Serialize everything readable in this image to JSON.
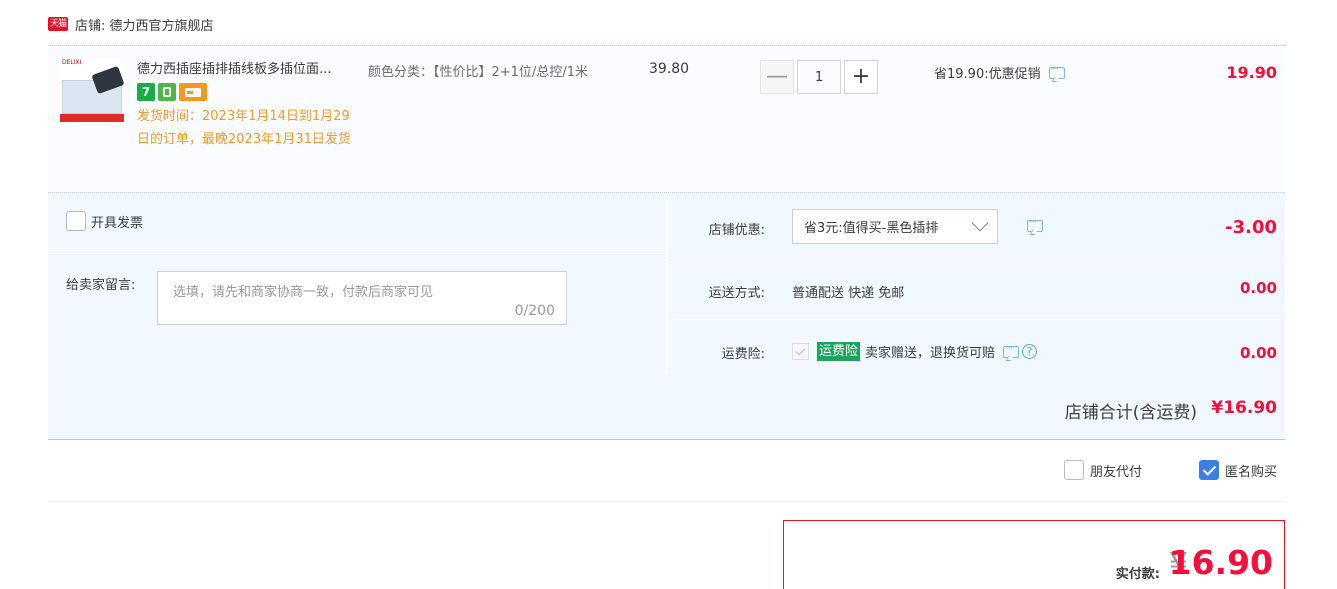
{
  "shop": {
    "badge": "天猫",
    "name": "店铺: 德力西官方旗舰店"
  },
  "item": {
    "title": "德力西插座插排插线板多插位面...",
    "badges": [
      {
        "type": "number",
        "text": "7"
      },
      {
        "type": "icon",
        "icon": "refund-icon"
      },
      {
        "type": "icon",
        "icon": "card-icon"
      }
    ],
    "ship_note": "发货时间：2023年1月14日到1月29日的订单，最晚2023年1月31日发货",
    "sku": "颜色分类：【性价比】2+1位/总控/1米",
    "unit_price": "39.80",
    "quantity": "1",
    "qty_minus": "—",
    "qty_plus": "+",
    "promo": "省19.90:优惠促销",
    "total": "19.90"
  },
  "invoice": {
    "label": "开具发票"
  },
  "message": {
    "label": "给卖家留言:",
    "placeholder": "选填，请先和商家协商一致，付款后商家可见",
    "count": "0/200"
  },
  "coupon": {
    "label": "店铺优惠:",
    "value": "省3元:值得买-黑色插排",
    "amount": "-3.00"
  },
  "shipping": {
    "label": "运送方式:",
    "value": "普通配送 快递 免邮",
    "amount": "0.00"
  },
  "insurance": {
    "label": "运费险:",
    "badge": "运费险",
    "text": "卖家赠送，退换货可赔",
    "help": "?",
    "amount": "0.00"
  },
  "shop_total": {
    "label": "店铺合计(含运费)",
    "amount": "¥16.90"
  },
  "extras": {
    "friend_pay": "朋友代付",
    "anonymous": "匿名购买",
    "anonymous_checked": true,
    "friend_checked": false
  },
  "payment": {
    "label": "实付款:",
    "currency": "¥",
    "amount": "16.90"
  },
  "colors": {
    "accent_red": "#f40f3b",
    "panel_blue": "#f2f8ff",
    "tmall_red": "#e4122c",
    "checkbox_blue": "#3d7fe8"
  }
}
